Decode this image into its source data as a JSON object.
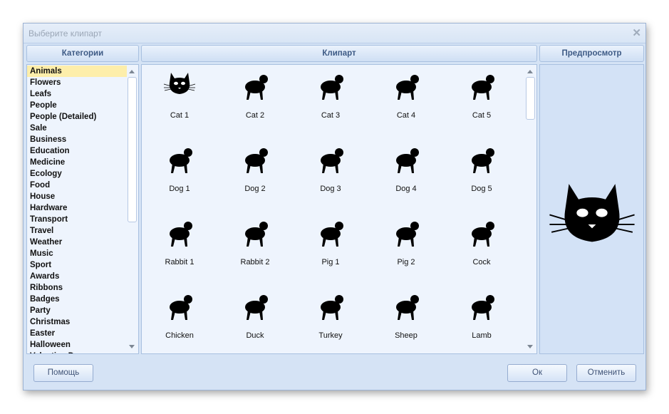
{
  "window": {
    "title": "Выберите клипарт",
    "close_icon": "close-icon"
  },
  "headers": {
    "categories": "Категории",
    "clipart": "Клипарт",
    "preview": "Предпросмотр"
  },
  "categories": {
    "selected": "Animals",
    "items": [
      "Animals",
      "Flowers",
      "Leafs",
      "People",
      "People (Detailed)",
      "Sale",
      "Business",
      "Education",
      "Medicine",
      "Ecology",
      "Food",
      "House",
      "Hardware",
      "Transport",
      "Travel",
      "Weather",
      "Music",
      "Sport",
      "Awards",
      "Ribbons",
      "Badges",
      "Party",
      "Christmas",
      "Easter",
      "Halloween",
      "Valentine Day"
    ]
  },
  "clipart": {
    "items": [
      {
        "label": "Cat 1",
        "icon": "cat-face"
      },
      {
        "label": "Cat 2",
        "icon": "cat-sitting"
      },
      {
        "label": "Cat 3",
        "icon": "cat-walking"
      },
      {
        "label": "Cat 4",
        "icon": "cat-stretching"
      },
      {
        "label": "Cat 5",
        "icon": "cat-walking"
      },
      {
        "label": "Dog 1",
        "icon": "dog-face"
      },
      {
        "label": "Dog 2",
        "icon": "dog-running"
      },
      {
        "label": "Dog 3",
        "icon": "poodle"
      },
      {
        "label": "Dog 4",
        "icon": "dog-jumping"
      },
      {
        "label": "Dog 5",
        "icon": "dog-standing"
      },
      {
        "label": "Rabbit 1",
        "icon": "rabbit-face"
      },
      {
        "label": "Rabbit 2",
        "icon": "rabbit-sitting"
      },
      {
        "label": "Pig 1",
        "icon": "pig-face"
      },
      {
        "label": "Pig 2",
        "icon": "pig"
      },
      {
        "label": "Cock",
        "icon": "cock"
      },
      {
        "label": "Chicken",
        "icon": "chicken"
      },
      {
        "label": "Duck",
        "icon": "duck"
      },
      {
        "label": "Turkey",
        "icon": "turkey"
      },
      {
        "label": "Sheep",
        "icon": "sheep"
      },
      {
        "label": "Lamb",
        "icon": "lamb"
      }
    ]
  },
  "preview": {
    "icon": "cat-face"
  },
  "buttons": {
    "help": "Помощь",
    "ok": "Ок",
    "cancel": "Отменить"
  }
}
